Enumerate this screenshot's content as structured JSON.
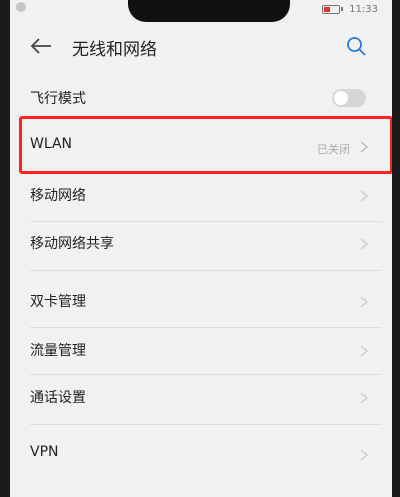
{
  "status_bar": {
    "time": "11:33"
  },
  "header": {
    "title": "无线和网络"
  },
  "rows": [
    {
      "label": "飞行模式",
      "type": "toggle"
    },
    {
      "label": "WLAN",
      "value": "已关闭"
    },
    {
      "label": "移动网络"
    },
    {
      "label": "移动网络共享"
    },
    {
      "label": "双卡管理"
    },
    {
      "label": "流量管理"
    },
    {
      "label": "通话设置"
    },
    {
      "label": "VPN"
    }
  ],
  "colors": {
    "highlight": "#ff2020",
    "background": "#f1f1f1"
  },
  "icons": [
    "back-arrow-icon",
    "search-icon",
    "chevron-right-icon",
    "battery-icon"
  ]
}
